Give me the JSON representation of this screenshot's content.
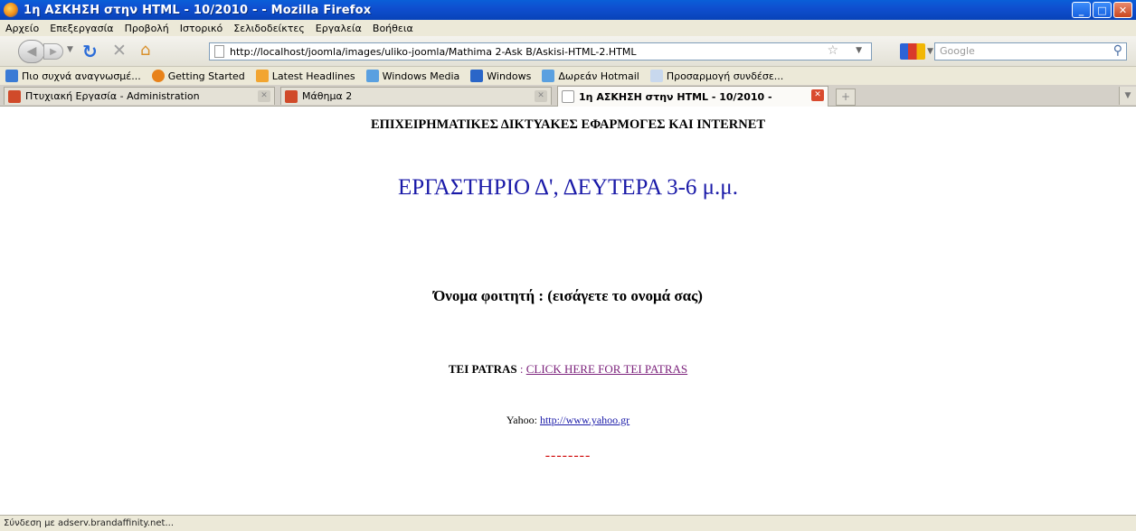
{
  "window": {
    "title": "1η ΑΣΚΗΣΗ στην HTML - 10/2010 - - Mozilla Firefox",
    "controls": {
      "minimize": "_",
      "maximize": "□",
      "close": "✕"
    }
  },
  "menubar": {
    "items": [
      "Αρχείο",
      "Επεξεργασία",
      "Προβολή",
      "Ιστορικό",
      "Σελιδοδείκτες",
      "Εργαλεία",
      "Βοήθεια"
    ]
  },
  "navbar": {
    "url": "http://localhost/joomla/images/uliko-joomla/Mathima 2-Ask B/Askisi-HTML-2.HTML",
    "search_placeholder": "Google",
    "icons": [
      "back-icon",
      "forward-icon",
      "reload-icon",
      "stop-icon",
      "home-icon",
      "star-icon",
      "search-icon"
    ]
  },
  "bookmarks": {
    "items": [
      {
        "label": "Πιο συχνά αναγνωσμέ...",
        "color": "#3a7bd5"
      },
      {
        "label": "Getting Started",
        "color": "#e8821a"
      },
      {
        "label": "Latest Headlines",
        "color": "#f2a530"
      },
      {
        "label": "Windows Media",
        "color": "#5aa0e0"
      },
      {
        "label": "Windows",
        "color": "#2a66c8"
      },
      {
        "label": "Δωρεάν Hotmail",
        "color": "#5aa0e0"
      },
      {
        "label": "Προσαρμογή συνδέσε...",
        "color": "#c8d8ee"
      }
    ]
  },
  "tabs": [
    {
      "label": "Πτυχιακή Εργασία - Administration",
      "active": false
    },
    {
      "label": "Μάθημα 2",
      "active": false
    },
    {
      "label": "1η ΑΣΚΗΣΗ στην HTML - 10/2010 -",
      "active": true
    }
  ],
  "content": {
    "heading1": "ΕΠΙΧΕΙΡΗΜΑΤΙΚΕΣ ΔΙΚΤΥΑΚΕΣ ΕΦΑΡΜΟΓΕΣ ΚΑΙ INTERNET",
    "heading2": "ΕΡΓΑΣΤΗΡΙΟ Δ', ΔΕΥΤΕΡΑ 3-6 μ.μ.",
    "student": "Όνομα φοιτητή : (εισάγετε το ονομά σας)",
    "tei_label": "TEI PATRAS",
    "tei_sep": " : ",
    "tei_link": "CLICK HERE FOR TEI PATRAS",
    "yahoo_label": "Yahoo: ",
    "yahoo_link": "http://www.yahoo.gr",
    "dashes": "--------"
  },
  "statusbar": {
    "text": "Σύνδεση με adserv.brandaffinity.net..."
  },
  "colors": {
    "heading2": "#1a1aa8",
    "visited_link": "#7a1f7a",
    "link": "#1a1aa8",
    "dashes": "#d42020",
    "titlebar": "#0f4fd0"
  }
}
